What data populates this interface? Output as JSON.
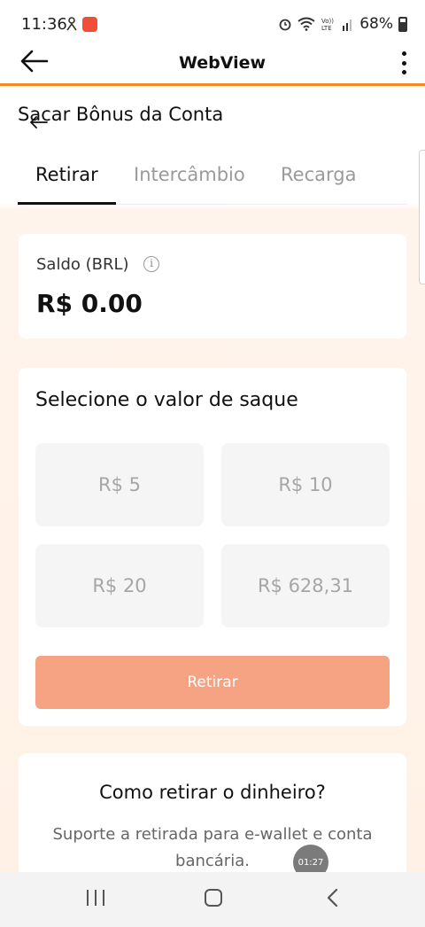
{
  "status_bar": {
    "time": "11:36",
    "battery": "68%",
    "icons": [
      "app-notification-icon",
      "app-badge-icon",
      "alarm-icon",
      "wifi-icon",
      "volte-icon",
      "signal-icon",
      "battery-icon"
    ]
  },
  "app_bar": {
    "title": "WebView",
    "back_icon": "arrow-left-icon",
    "menu_icon": "more-vertical-icon",
    "accent_color": "#f28a1e"
  },
  "page": {
    "title": "Sacar Bônus da Conta",
    "tabs": [
      {
        "label": "Retirar",
        "active": true
      },
      {
        "label": "Intercâmbio",
        "active": false
      },
      {
        "label": "Recarga",
        "active": false
      }
    ]
  },
  "balance": {
    "label": "Saldo (BRL)",
    "info_icon": "info-icon",
    "value": "R$ 0.00"
  },
  "withdraw": {
    "title": "Selecione o valor de saque",
    "amounts": [
      "R$ 5",
      "R$ 10",
      "R$ 20",
      "R$ 628,31"
    ],
    "button_label": "Retirar",
    "button_color": "#f6a384"
  },
  "info": {
    "title": "Como retirar o dinheiro?",
    "text": "Suporte a retirada para e-wallet e conta bancária."
  },
  "overlay": {
    "timer": "01:27"
  },
  "nav_bar": {
    "icons": [
      "recent-apps-icon",
      "home-icon",
      "back-icon"
    ]
  }
}
